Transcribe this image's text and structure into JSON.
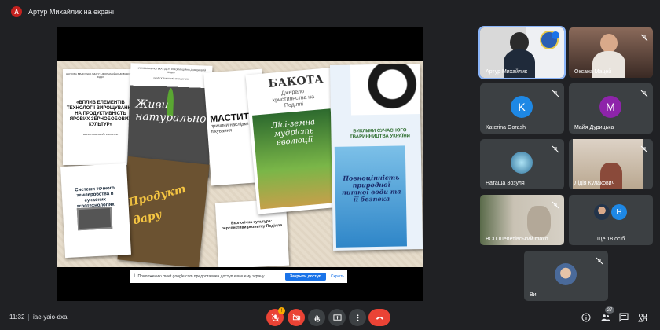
{
  "top_bar": {
    "avatar_letter": "A",
    "title": "Артур Михайлик на екрані"
  },
  "slide": {
    "book1": {
      "header": "НАУКОВА БІБЛІОТЕКА ПДАТУ ІНФОРМАЦІЙНО-ДОВІДКОВИЙ ВІДДІЛ",
      "title": "«ВПЛИВ ЕЛЕМЕНТІВ ТЕХНОЛОГІЇ ВИРОЩУВАННЯ НА ПРОДУКТИВНІСТЬ ЯРОВИХ ЗЕРНОБОБОВИХ КУЛЬТУР»",
      "subtitle": "БІБЛІОГРАФІЧНИЙ ПОКАЖЧИК"
    },
    "book2": {
      "header": "НАУКОВА БІБЛІОТЕКА ПДАТУ ІНФОРМАЦІЙНО-ДОВІДКОВИЙ ВІДДІЛ",
      "subtitle": "БІБЛІОГРАФІЧНИЙ ПОКАЖЧИК",
      "title": "Живи натурально"
    },
    "book3": {
      "title": "МАСТИТ:",
      "subtitle": "причини наслідки лікування"
    },
    "book4": {
      "title": "БАКОТА",
      "subtitle": "Джерело християнства на Поділлі",
      "forest_title": "Лісі-земна мудрість еволюції"
    },
    "book5": {
      "title": "ВИКЛИКИ СУЧАСНОГО ТВАРИННИЦТВА УКРАЇНИ",
      "water_title": "Повноцінність природної питної води та її безпека"
    },
    "book6": {
      "title": "Системи точного землеробства в сучасних агротехнологіях"
    },
    "book7": {
      "title": "Продукт дару"
    },
    "book8": {
      "title": "Екологічна культура: перспективи розвитку Поділля"
    },
    "share_notice": {
      "text": "Приложению meet.google.com предоставлен доступ к вашему экрану.",
      "stop_button": "Закрыть доступ",
      "hide_button": "Скрыть"
    }
  },
  "participants": [
    {
      "name": "Артур Михайлик"
    },
    {
      "name": "Оксана Мацей"
    },
    {
      "name": "Katerina Gorash",
      "initial": "K",
      "color": "#1e88e5"
    },
    {
      "name": "Майя Дурицька",
      "initial": "M",
      "color": "#8e24aa"
    },
    {
      "name": "Наташа Зозуля"
    },
    {
      "name": "Лідія Кулакович"
    },
    {
      "name": "ВСП Шепетівський фахо..."
    },
    {
      "name": "Ще 18 осіб",
      "initial": "H",
      "color": "#1e88e5"
    },
    {
      "name": "Ви"
    }
  ],
  "bottom_bar": {
    "time": "11:32",
    "meeting_code": "iae-yaio-dxa",
    "mic_badge": "!",
    "people_count": "27"
  },
  "colors": {
    "accent": "#8ab4f8",
    "danger": "#ea4335",
    "tile_bg": "#3c4043"
  }
}
